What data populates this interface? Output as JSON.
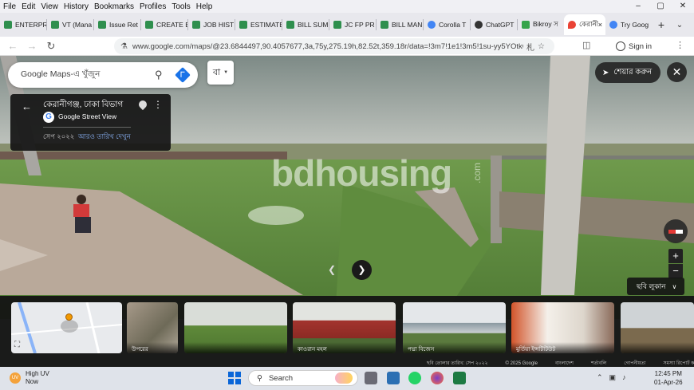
{
  "menubar": {
    "items": [
      "File",
      "Edit",
      "View",
      "History",
      "Bookmarks",
      "Profiles",
      "Tools",
      "Help"
    ]
  },
  "window_controls": {
    "minimize": "–",
    "maximize": "▢",
    "close": "✕"
  },
  "tabs": [
    {
      "label": "ENTERPR",
      "color": "#2f8f4e"
    },
    {
      "label": "VT (Mana",
      "color": "#2f8f4e"
    },
    {
      "label": "Issue Ret",
      "color": "#2f8f4e"
    },
    {
      "label": "CREATE E",
      "color": "#2f8f4e"
    },
    {
      "label": "JOB HIST",
      "color": "#2f8f4e"
    },
    {
      "label": "ESTIMATE",
      "color": "#2f8f4e"
    },
    {
      "label": "BILL SUM",
      "color": "#2f8f4e"
    },
    {
      "label": "JC FP PR",
      "color": "#2f8f4e"
    },
    {
      "label": "BILL MAN",
      "color": "#2f8f4e"
    },
    {
      "label": "Corolla T",
      "color": "#4285f4"
    },
    {
      "label": "ChatGPT",
      "color": "#333333"
    },
    {
      "label": "Bikroy স",
      "color": "#35a44a"
    },
    {
      "label": "কেরানী",
      "color": "#ea4335",
      "active": true
    },
    {
      "label": "Try Goog",
      "color": "#4285f4"
    }
  ],
  "tab_close": "×",
  "tab_new": "+",
  "tab_list": "⌄",
  "nav": {
    "back": "←",
    "forward": "→",
    "reload": "↻",
    "url": "www.google.com/maps/@23.6844497,90.4057677,3a,75y,275.19h,82.52t,359.18r/data=!3m7!1e1!3m5!1su-yy5YOtkC45051jZkoD",
    "sign_in": "Sign in"
  },
  "maps": {
    "search_placeholder": "Google Maps-এ খুঁজুন",
    "lang_button": "বা",
    "share_label": "শেয়ার করুন",
    "info": {
      "location": "কেরানীগঞ্জ, ঢাকা বিভাগ",
      "source": "Google Street View",
      "date": "সেপ ২০২২",
      "more_dates": "আরও তারিখ দেখুন"
    },
    "watermark": "bdhousing",
    "watermark_suffix": ".com",
    "hide_images": "ছবি লুকান",
    "thumbnails": [
      {
        "caption": "উপরের"
      },
      {
        "caption": ""
      },
      {
        "caption": "কাওরান মহল"
      },
      {
        "caption": "পদ্মা বিজেস"
      },
      {
        "caption": "মুর্তিয়া ইন্সটিটিউট"
      },
      {
        "caption": ""
      }
    ],
    "minimap_label": "Khilgaon",
    "attribution": [
      "ছবি তোলার তারিখ: সেপ ২০২২",
      "© 2025 Google",
      "বাংলাদেশ",
      "শর্তাবলি",
      "গোপনীয়তা",
      "সমস্যা রিপোর্ট করুন"
    ]
  },
  "taskbar": {
    "weather_title": "High UV",
    "weather_sub": "Now",
    "search_label": "Search",
    "time": "12:45 PM",
    "date": "01-Apr-26"
  }
}
